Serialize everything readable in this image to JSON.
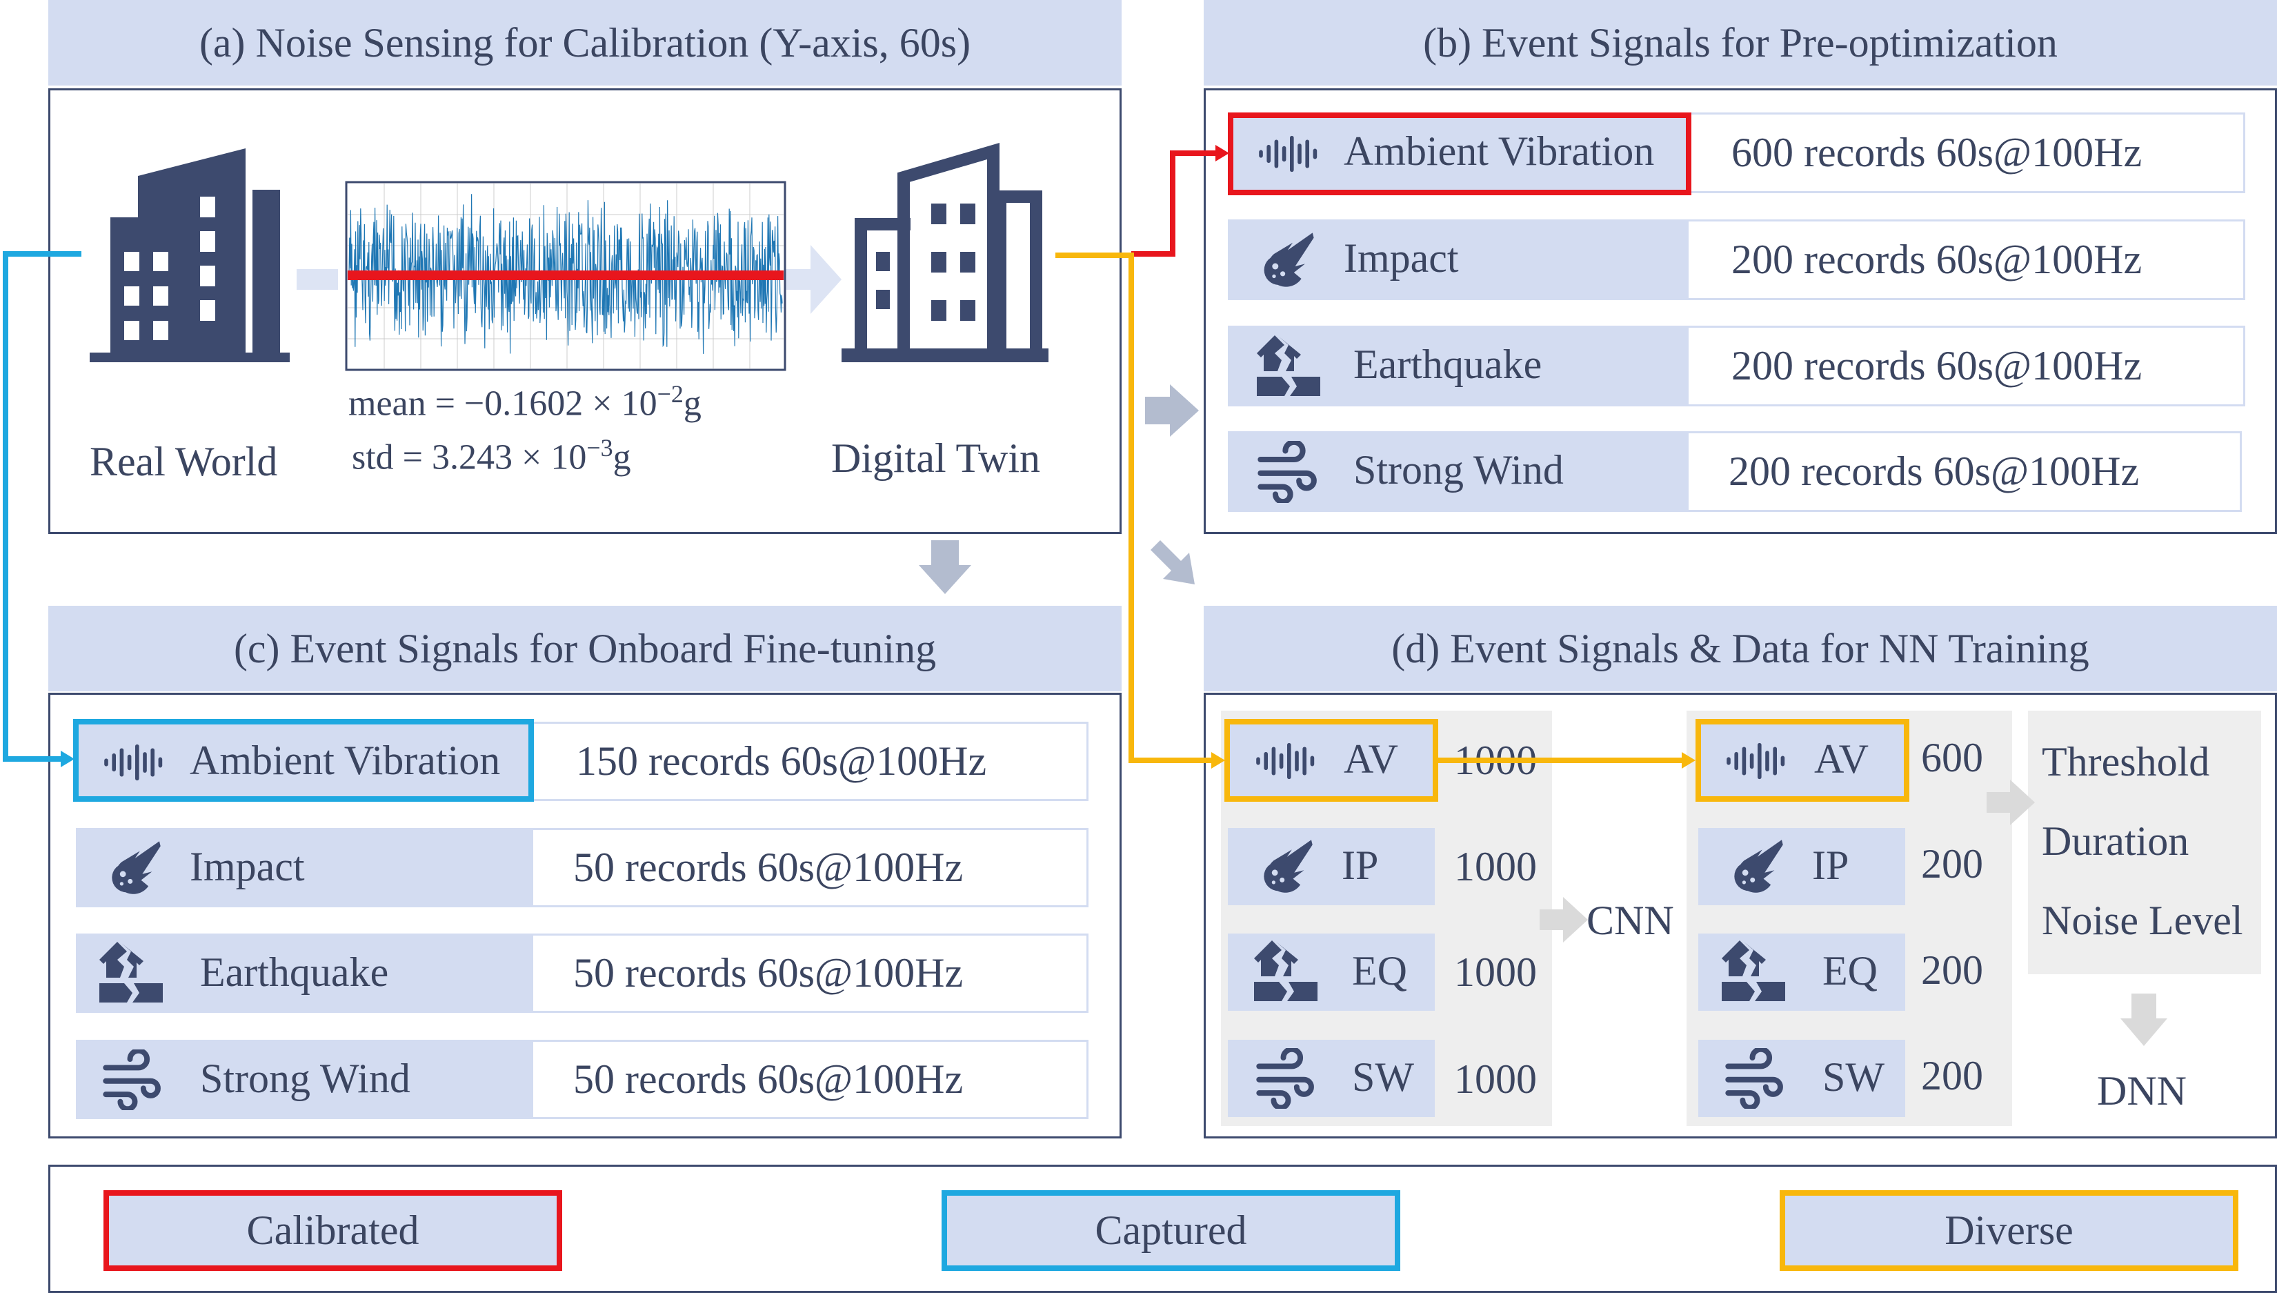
{
  "panels": {
    "a": {
      "title": "(a) Noise Sensing for Calibration (Y-axis, 60s)",
      "left_label": "Real World",
      "right_label": "Digital Twin",
      "mean_text": "mean = −0.1602 × 10",
      "mean_exp": "−2",
      "mean_unit": "g",
      "std_text": "std = 3.243 × 10",
      "std_exp": "−3",
      "std_unit": "g"
    },
    "b": {
      "title": "(b) Event Signals for Pre-optimization",
      "rows": [
        {
          "label": "Ambient Vibration",
          "value": "600 records 60s@100Hz",
          "icon": "waveform-icon"
        },
        {
          "label": "Impact",
          "value": "200 records 60s@100Hz",
          "icon": "meteor-icon"
        },
        {
          "label": "Earthquake",
          "value": "200 records 60s@100Hz",
          "icon": "house-crack-icon"
        },
        {
          "label": "Strong Wind",
          "value": "200 records 60s@100Hz",
          "icon": "wind-icon"
        }
      ]
    },
    "c": {
      "title": "(c) Event Signals for Onboard Fine-tuning",
      "rows": [
        {
          "label": "Ambient Vibration",
          "value": "150 records 60s@100Hz",
          "icon": "waveform-icon"
        },
        {
          "label": "Impact",
          "value": "50 records 60s@100Hz",
          "icon": "meteor-icon"
        },
        {
          "label": "Earthquake",
          "value": "50 records 60s@100Hz",
          "icon": "house-crack-icon"
        },
        {
          "label": "Strong Wind",
          "value": "50 records 60s@100Hz",
          "icon": "wind-icon"
        }
      ]
    },
    "d": {
      "title": "(d) Event Signals & Data for NN Training",
      "left_rows": [
        {
          "label": "AV",
          "value": "1000"
        },
        {
          "label": "IP",
          "value": "1000"
        },
        {
          "label": "EQ",
          "value": "1000"
        },
        {
          "label": "SW",
          "value": "1000"
        }
      ],
      "cnn": "CNN",
      "right_rows": [
        {
          "label": "AV",
          "value": "600"
        },
        {
          "label": "IP",
          "value": "200"
        },
        {
          "label": "EQ",
          "value": "200"
        },
        {
          "label": "SW",
          "value": "200"
        }
      ],
      "features": [
        "Threshold",
        "Duration",
        "Noise Level"
      ],
      "dnn": "DNN"
    }
  },
  "legend": {
    "calibrated": "Calibrated",
    "captured": "Captured",
    "diverse": "Diverse"
  },
  "colors": {
    "calibrated": "#e8161d",
    "captured": "#1ea8e0",
    "diverse": "#f8b70c",
    "band": "#d3dcf1",
    "icon": "#3d4a6e",
    "signal": "#1f77b4"
  }
}
